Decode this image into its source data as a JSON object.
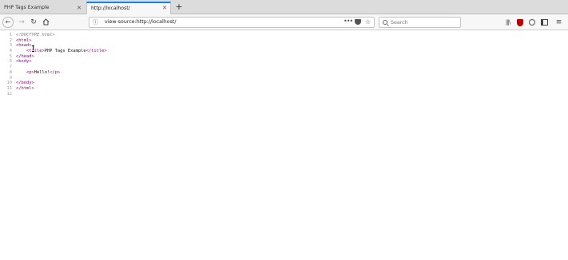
{
  "tabs": [
    {
      "title": "PHP Tags Example",
      "active": false
    },
    {
      "title": "http://localhost/",
      "active": true
    }
  ],
  "toolbar": {
    "new_tab_glyph": "+",
    "back_icon": "arrow-left-icon",
    "forward_icon": "arrow-right-icon",
    "reload_icon": "reload-icon",
    "home_icon": "home-icon"
  },
  "urlbar": {
    "value": "view-source:http://localhost/",
    "more_glyph": "•••"
  },
  "search": {
    "placeholder": "Search"
  },
  "source_lines": [
    {
      "n": "1",
      "parts": [
        {
          "t": "<!DOCTYPE html>",
          "k": "doctype"
        }
      ]
    },
    {
      "n": "2",
      "parts": [
        {
          "t": "<html>",
          "k": "tag"
        }
      ]
    },
    {
      "n": "3",
      "parts": [
        {
          "t": "<head>",
          "k": "tag"
        }
      ]
    },
    {
      "n": "4",
      "parts": [
        {
          "t": "    ",
          "k": "text"
        },
        {
          "t": "<title>",
          "k": "tag"
        },
        {
          "t": "PHP Tags Example",
          "k": "text"
        },
        {
          "t": "</title>",
          "k": "tag"
        }
      ]
    },
    {
      "n": "5",
      "parts": [
        {
          "t": "</head>",
          "k": "tag"
        }
      ]
    },
    {
      "n": "6",
      "parts": [
        {
          "t": "<body>",
          "k": "tag"
        }
      ]
    },
    {
      "n": "7",
      "parts": []
    },
    {
      "n": "8",
      "parts": [
        {
          "t": "    ",
          "k": "text"
        },
        {
          "t": "<p>",
          "k": "tag"
        },
        {
          "t": "Hello!",
          "k": "text"
        },
        {
          "t": "</p>",
          "k": "tag"
        }
      ]
    },
    {
      "n": "9",
      "parts": []
    },
    {
      "n": "10",
      "parts": [
        {
          "t": "</body>",
          "k": "tag"
        }
      ]
    },
    {
      "n": "11",
      "parts": [
        {
          "t": "</html>",
          "k": "tag"
        }
      ]
    },
    {
      "n": "12",
      "parts": []
    }
  ],
  "colors": {
    "accent": "#0a84ff",
    "tag": "#8b008b",
    "doctype": "#7a7a7a",
    "line_number": "#a0a0a0",
    "ublock": "#c00000"
  }
}
